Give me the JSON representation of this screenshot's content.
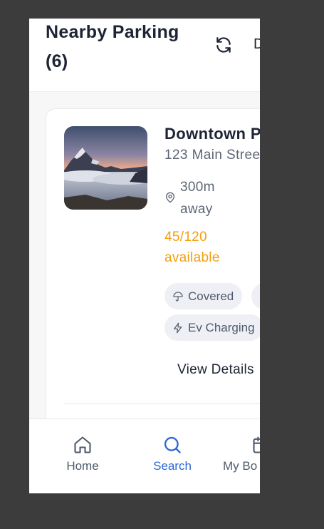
{
  "header": {
    "title": "Nearby Parking (6)",
    "refresh_icon": "refresh-icon",
    "action_label": "D"
  },
  "card": {
    "name": "Downtown P",
    "address": "123 Main Stree",
    "distance": "300m away",
    "availability": "45/120 available",
    "availability_color": "#f29f0d",
    "chips": [
      {
        "label": "Covered",
        "icon": "umbrella-icon"
      },
      {
        "label": "Ev Charging",
        "icon": "bolt-icon"
      }
    ],
    "details_label": "View Details"
  },
  "nav": {
    "items": [
      {
        "label": "Home",
        "icon": "home-icon"
      },
      {
        "label": "Search",
        "icon": "search-icon"
      },
      {
        "label": "My Bo",
        "icon": "calendar-icon"
      }
    ],
    "active_color": "#2d67d6"
  }
}
